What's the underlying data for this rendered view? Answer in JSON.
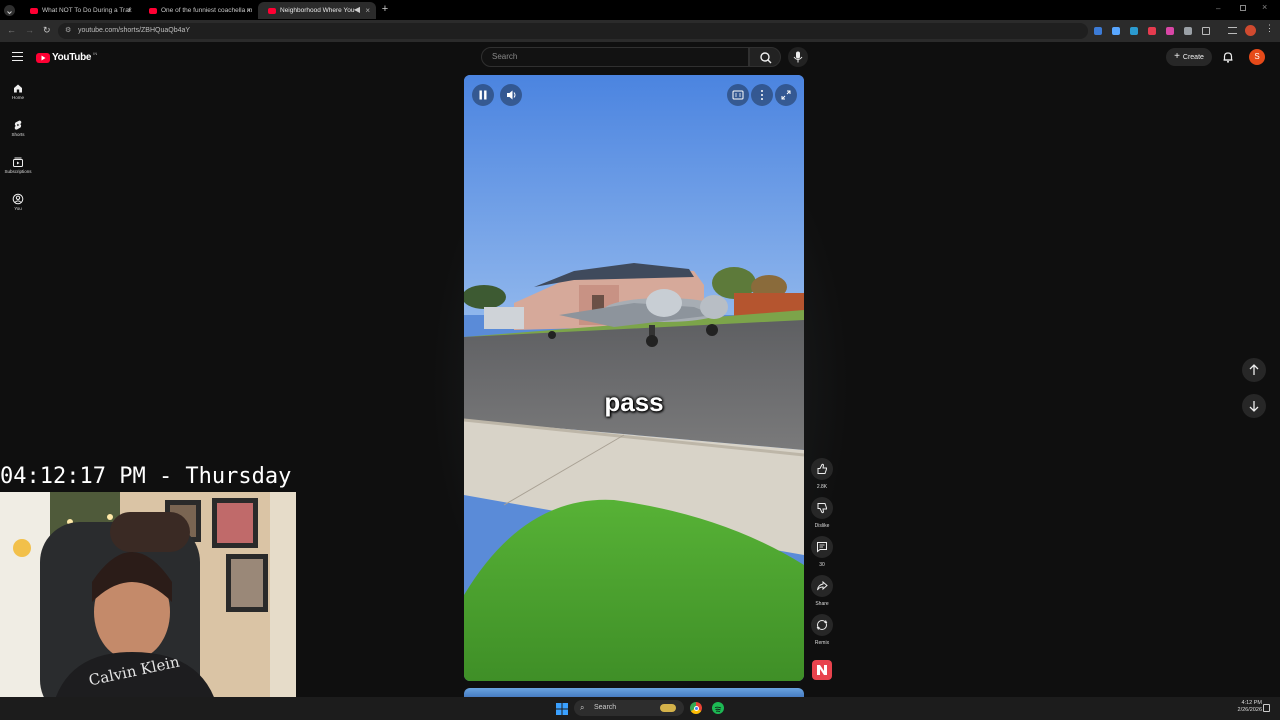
{
  "browser": {
    "tabs": [
      {
        "title": "What NOT To Do During a Traf"
      },
      {
        "title": "One of the funniest coachella m"
      },
      {
        "title": "Neighborhood Where You"
      }
    ],
    "url": "youtube.com/shorts/ZBHQuaQb4aY"
  },
  "youtube": {
    "logo_text": "YouTube",
    "logo_sup": "IN",
    "search_placeholder": "Search",
    "create_label": "Create",
    "avatar_letter": "S",
    "guide": [
      {
        "label": "Home",
        "icon": "home-icon"
      },
      {
        "label": "Shorts",
        "icon": "shorts-icon"
      },
      {
        "label": "Subscriptions",
        "icon": "subscriptions-icon"
      },
      {
        "label": "You",
        "icon": "you-icon"
      }
    ]
  },
  "video": {
    "caption": "pass",
    "player_state": "playing"
  },
  "actions": {
    "like_count": "2.8K",
    "dislike_label": "Dislike",
    "comment_count": "30",
    "share_label": "Share",
    "remix_label": "Remix"
  },
  "overlay": {
    "clock": "04:12:17 PM - Thursday",
    "shirt_text": "Calvin Klein"
  },
  "taskbar": {
    "search_label": "Search",
    "time": "4:12 PM",
    "date": "2/26/2026"
  },
  "colors": {
    "accent_red": "#ff0033",
    "background": "#0f0f0f",
    "sky": "#5a8bd8"
  }
}
